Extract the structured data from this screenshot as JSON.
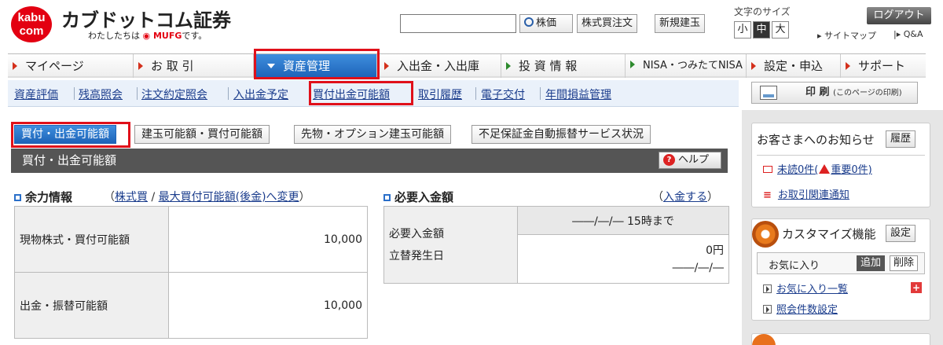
{
  "header": {
    "logo_top": "kabu",
    "logo_bottom": "com",
    "brand_name": "カブドットコム証券",
    "tagline_pre": "わたしたちは",
    "tagline_mufg": "MUFG",
    "tagline_post": "です。",
    "search_placeholder": "",
    "search_button": "株価",
    "order_button": "株式買注文",
    "new_position_button": "新規建玉",
    "font_size_label": "文字のサイズ",
    "font_small": "小",
    "font_medium": "中",
    "font_large": "大",
    "logout": "ログアウト",
    "sitemap": "▸ サイトマップ",
    "qa": "|▸ Q&A"
  },
  "global_nav": [
    {
      "label": "マイページ"
    },
    {
      "label": "お 取 引"
    },
    {
      "label": "資産管理"
    },
    {
      "label": "入出金・入出庫"
    },
    {
      "label": "投 資 情 報"
    },
    {
      "label": "NISA・つみたてNISA"
    },
    {
      "label": "設定・申込"
    },
    {
      "label": "サポート"
    }
  ],
  "sub_nav": [
    {
      "label": "資産評価"
    },
    {
      "label": "残高照会"
    },
    {
      "label": "注文約定照会"
    },
    {
      "label": "入出金予定"
    },
    {
      "label": "買付出金可能額"
    },
    {
      "label": "取引履歴"
    },
    {
      "label": "電子交付"
    },
    {
      "label": "年間損益管理"
    }
  ],
  "print": {
    "label": "印 刷",
    "sub": "(このページの印刷)"
  },
  "content_tabs": [
    {
      "label": "買付・出金可能額"
    },
    {
      "label": "建玉可能額・買付可能額"
    },
    {
      "label": "先物・オプション建玉可能額"
    },
    {
      "label": "不足保証金自動振替サービス状況"
    }
  ],
  "page_title": "買付・出金可能額",
  "help_label": "ヘルプ",
  "help_icon_glyph": "?",
  "section1": {
    "title": "余力情報",
    "paren_open": "（",
    "link1": "株式買",
    "slash": " / ",
    "link2": "最大買付可能額(後金)へ変更",
    "paren_close": "）",
    "rows": [
      {
        "label": "現物株式・買付可能額",
        "value": "10,000"
      },
      {
        "label": "出金・振替可能額",
        "value": "10,000"
      }
    ]
  },
  "section2": {
    "title": "必要入金額",
    "paren_open": "（",
    "link": "入金する",
    "paren_close": "）",
    "date_header": "――/―/― 15時まで",
    "label1": "必要入金額",
    "label2": "立替発生日",
    "amount": "0円",
    "date": "――/―/―"
  },
  "sidebar": {
    "notice_title": "お客さまへのお知らせ",
    "history_btn": "履歴",
    "unread": "未読0件(",
    "important": "重要0件)",
    "trade_notice": "お取引関連通知",
    "list_glyph": "≡",
    "customize_title": "カスタマイズ機能",
    "setting_btn": "設定",
    "fav_label": "お気に入り",
    "add_btn": "追加",
    "delete_btn": "削除",
    "fav_list": "お気に入り一覧",
    "plus_glyph": "+",
    "view_count": "照会件数設定"
  }
}
